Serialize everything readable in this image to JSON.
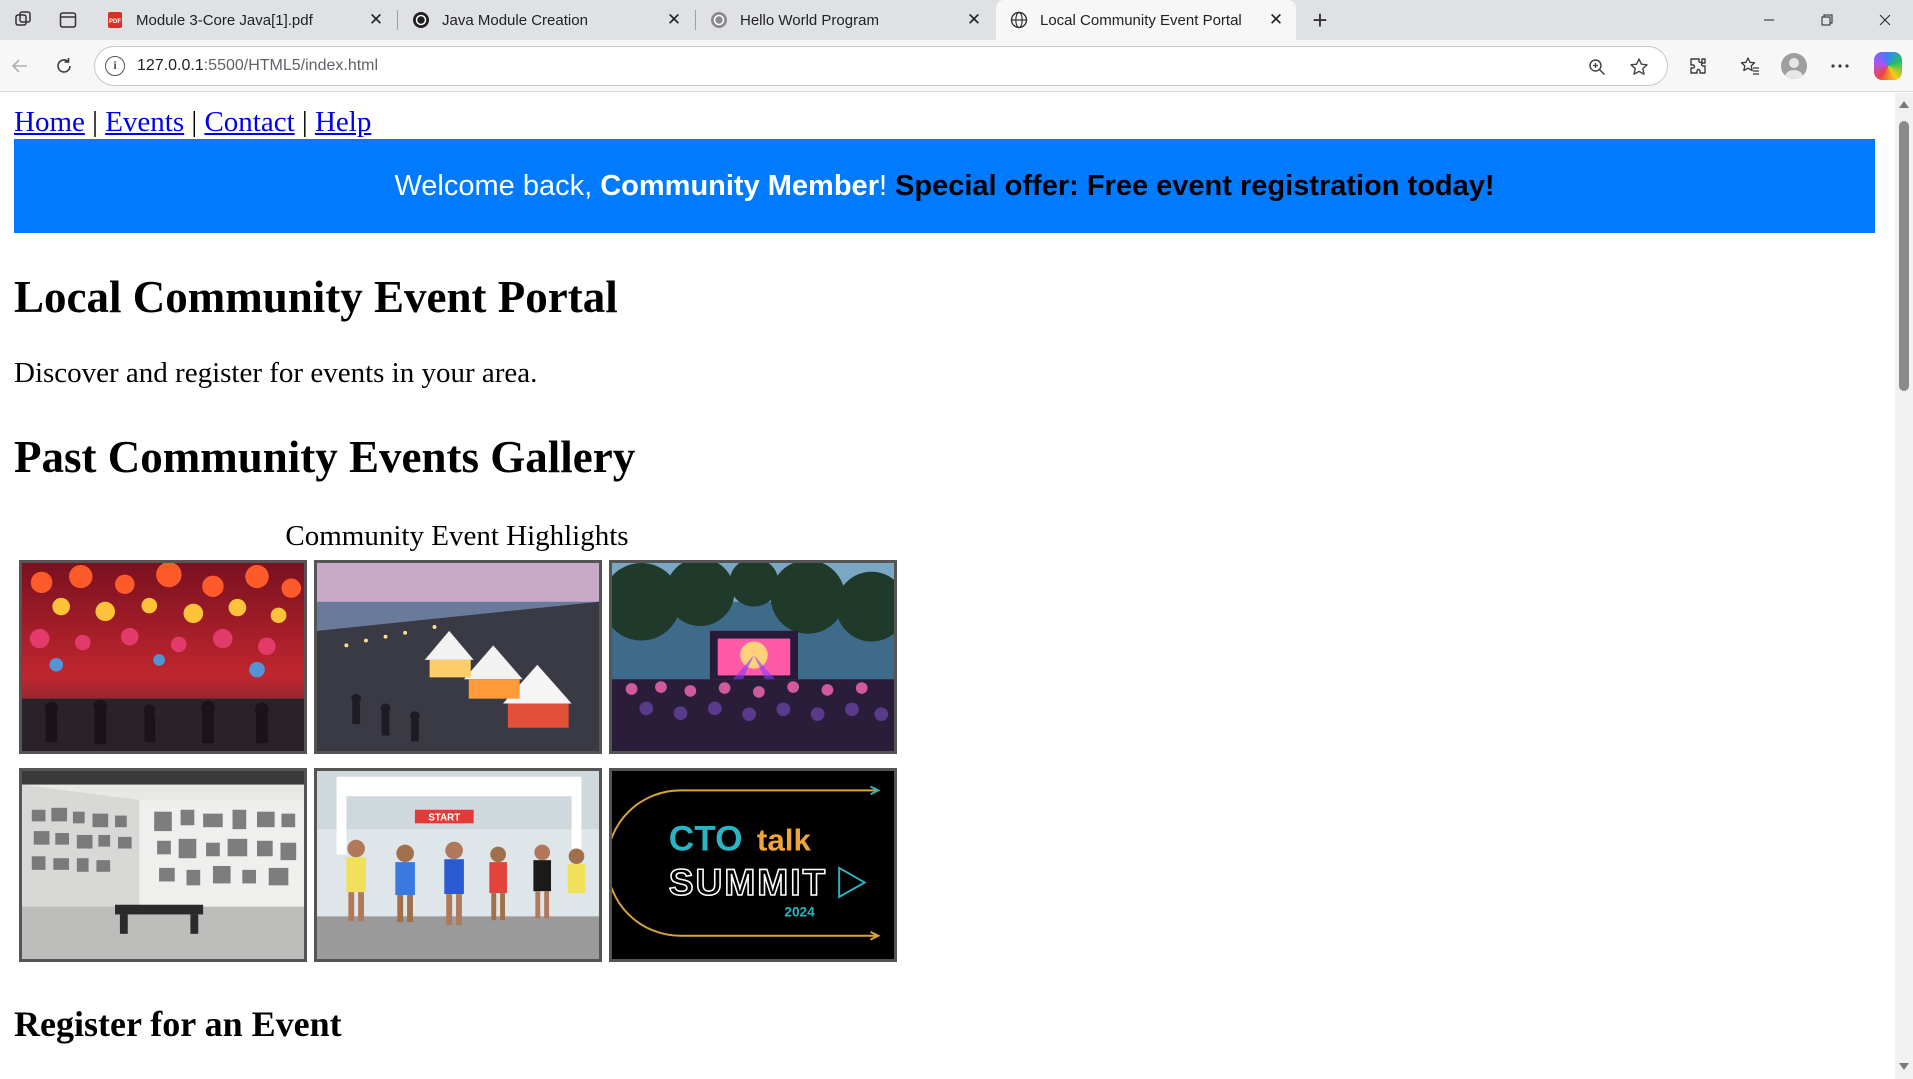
{
  "browser": {
    "tabs": [
      {
        "title": "Module 3-Core Java[1].pdf",
        "favicon": "pdf-icon",
        "active": false
      },
      {
        "title": "Java Module Creation",
        "favicon": "openai-icon",
        "active": false
      },
      {
        "title": "Hello World Program",
        "favicon": "openai-icon",
        "active": false
      },
      {
        "title": "Local Community Event Portal",
        "favicon": "globe-icon",
        "active": true
      }
    ],
    "url": {
      "host": "127.0.0.1",
      "rest": ":5500/HTML5/index.html"
    },
    "new_tab_glyph": "+",
    "close_glyph": "✕"
  },
  "page": {
    "nav": [
      {
        "label": "Home"
      },
      {
        "label": "Events"
      },
      {
        "label": "Contact"
      },
      {
        "label": "Help"
      }
    ],
    "nav_separator": "|",
    "banner": {
      "prefix": "Welcome back, ",
      "name": "Community Member",
      "suffix": "!",
      "offer": "Special offer: Free event registration today!",
      "background": "#007bff"
    },
    "title": "Local Community Event Portal",
    "tagline": "Discover and register for events in your area.",
    "gallery_title": "Past Community Events Gallery",
    "gallery_caption": "Community Event Highlights",
    "gallery_images": [
      {
        "name": "lantern-festival-photo"
      },
      {
        "name": "waterfront-market-photo"
      },
      {
        "name": "outdoor-concert-photo"
      },
      {
        "name": "art-gallery-photo"
      },
      {
        "name": "marathon-start-photo",
        "banner_text": "START"
      },
      {
        "name": "cto-talk-summit-photo",
        "logo_line1": "CTO",
        "logo_line1b": "talk",
        "logo_line2": "SUMMIT",
        "logo_year": "2024"
      }
    ],
    "register_title": "Register for an Event"
  }
}
